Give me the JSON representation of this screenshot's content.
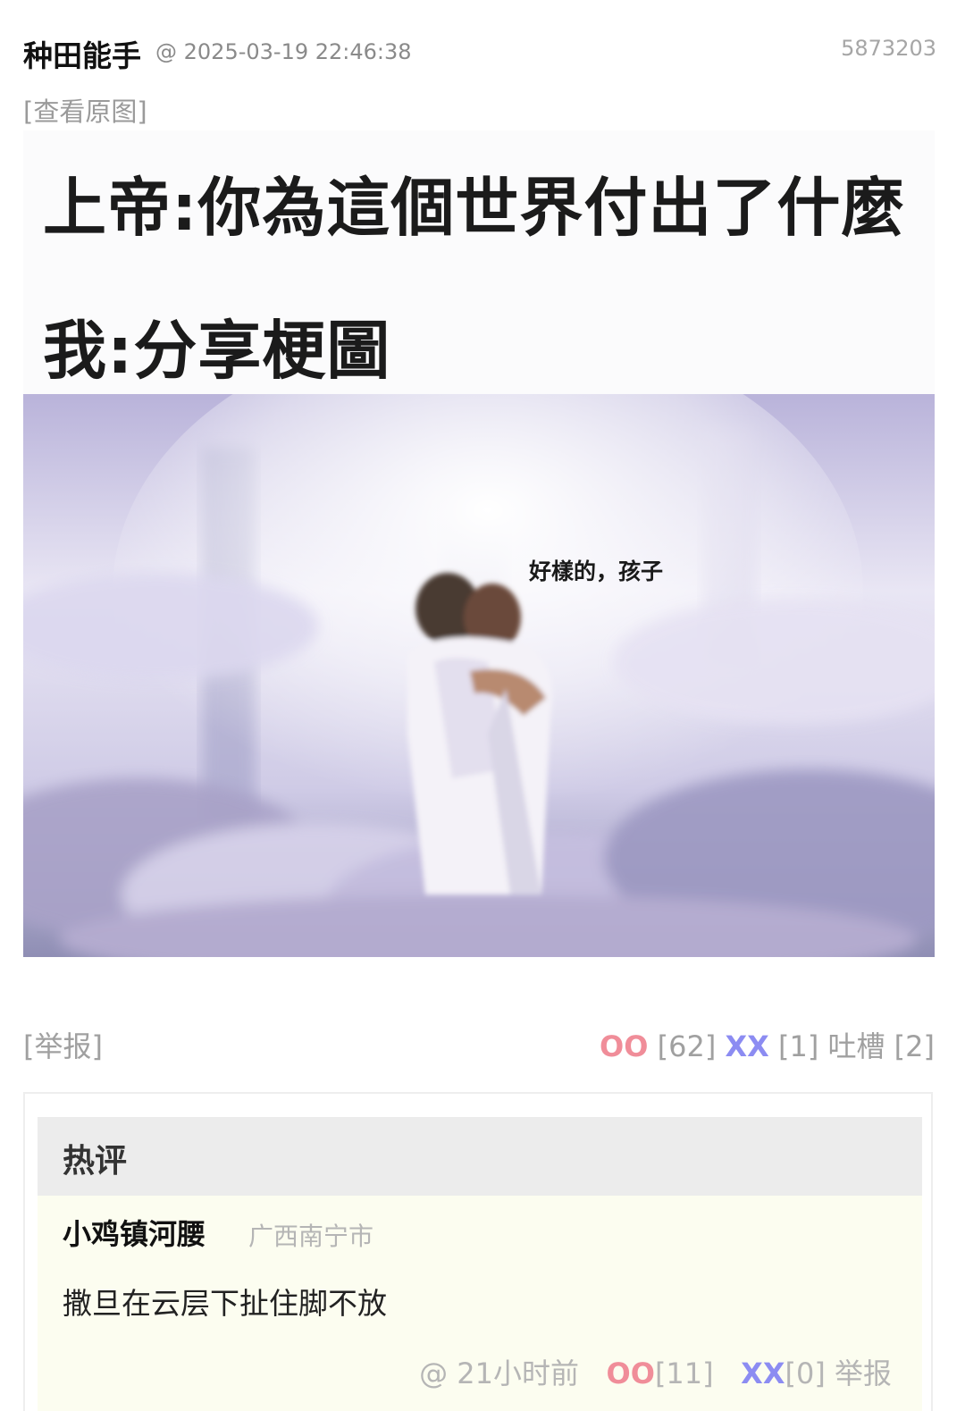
{
  "post": {
    "author": "种田能手",
    "time": "@ 2025-03-19 22:46:38",
    "id": "5873203",
    "view_original": "[查看原图]"
  },
  "meme": {
    "line1": "上帝:你為這個世界付出了什麼",
    "line2": "我:分享梗圖",
    "caption": "好樣的，孩子"
  },
  "actions": {
    "report": "[举报]",
    "oo_label": "OO",
    "oo_count": "[62]",
    "xx_label": "XX",
    "xx_count": "[1]",
    "tucao_label": "吐槽",
    "tucao_count": "[2]"
  },
  "hot_comments": {
    "title": "热评",
    "items": [
      {
        "author": "小鸡镇河腰",
        "location": "广西南宁市",
        "text": "撒旦在云层下扯住脚不放",
        "time": "@ 21小时前",
        "oo_label": "OO",
        "oo_count": "[11]",
        "xx_label": "XX",
        "xx_count": "[0]",
        "report": "举报"
      }
    ]
  },
  "colors": {
    "oo": "#f08d99",
    "xx": "#8c8cf2",
    "hot_bg": "#fcfdf0",
    "hot_title_bg": "#ececec"
  }
}
